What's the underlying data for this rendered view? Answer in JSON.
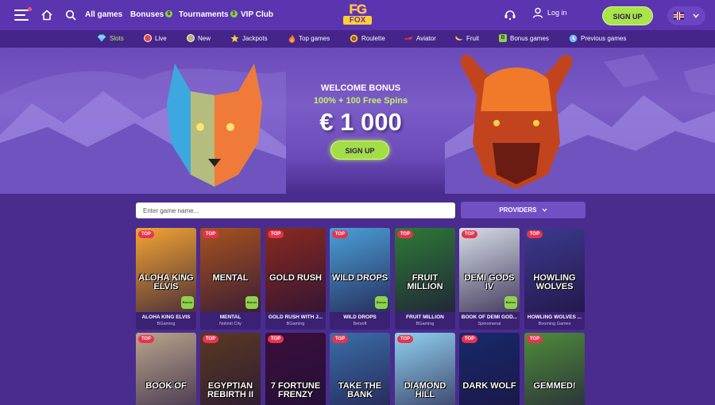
{
  "header": {
    "nav": [
      {
        "label": "All games",
        "badge": ""
      },
      {
        "label": "Bonuses",
        "badge": "6"
      },
      {
        "label": "Tournaments",
        "badge": "3"
      },
      {
        "label": "VIP Club",
        "badge": ""
      }
    ],
    "logo": {
      "line1": "FG",
      "line2": "FOX"
    },
    "login_label": "Log in",
    "signup_label": "SIGN UP",
    "language": "en-GB"
  },
  "categories": [
    {
      "label": "Slots",
      "icon": "diamond-icon",
      "active": true,
      "color": "#5ad1f0"
    },
    {
      "label": "Live",
      "icon": "live-ball-icon",
      "active": false,
      "color": "#e84545"
    },
    {
      "label": "New",
      "icon": "new-badge-icon",
      "active": false,
      "color": "#b9b36b"
    },
    {
      "label": "Jackpots",
      "icon": "star-icon",
      "active": false,
      "color": "#f7d23e"
    },
    {
      "label": "Top games",
      "icon": "fire-icon",
      "active": false,
      "color": "#ff7a2b"
    },
    {
      "label": "Roulette",
      "icon": "roulette-icon",
      "active": false,
      "color": "#f5b942"
    },
    {
      "label": "Aviator",
      "icon": "plane-icon",
      "active": false,
      "color": "#e33b4f"
    },
    {
      "label": "Fruit",
      "icon": "banana-icon",
      "active": false,
      "color": "#f8dd5a"
    },
    {
      "label": "Bonus games",
      "icon": "bonus-b-icon",
      "active": false,
      "color": "#8fd14f"
    },
    {
      "label": "Previous games",
      "icon": "history-icon",
      "active": false,
      "color": "#7ab8f5"
    }
  ],
  "hero": {
    "title": "WELCOME BONUS",
    "subtitle": "100% + 100 Free Spins",
    "amount": "€ 1 000",
    "button": "SIGN UP"
  },
  "search": {
    "placeholder": "Enter game name..."
  },
  "providers_label": "PROVIDERS",
  "games_row1": [
    {
      "name": "ALOHA KING ELVIS",
      "provider": "BGaming",
      "top": "TOP",
      "bonus": "Bonus",
      "art_text": "ALOHA KING ELVIS",
      "bg": "#f4a532"
    },
    {
      "name": "MENTAL",
      "provider": "Nolimit City",
      "top": "TOP",
      "bonus": "Bonus",
      "art_text": "MENTAL",
      "bg": "#a8521f"
    },
    {
      "name": "GOLD RUSH WITH J...",
      "provider": "BGaming",
      "top": "TOP",
      "bonus": "",
      "art_text": "GOLD RUSH",
      "bg": "#8a2a1e"
    },
    {
      "name": "WILD DROPS",
      "provider": "Betsoft",
      "top": "TOP",
      "bonus": "Bonus",
      "art_text": "WILD DROPS",
      "bg": "#4aa0d8"
    },
    {
      "name": "FRUIT MILLION",
      "provider": "BGaming",
      "top": "TOP",
      "bonus": "",
      "art_text": "FRUIT MILLION",
      "bg": "#2e7a36"
    },
    {
      "name": "BOOK OF DEMI GOD...",
      "provider": "Spinomenal",
      "top": "TOP",
      "bonus": "Bonus",
      "art_text": "DEMI GODS IV",
      "bg": "#d6dde6"
    },
    {
      "name": "HOWLING WOLVES ...",
      "provider": "Booming Games",
      "top": "TOP",
      "bonus": "",
      "art_text": "HOWLING WOLVES",
      "bg": "#3c3a8e"
    }
  ],
  "games_row2": [
    {
      "top": "TOP",
      "art_text": "BOOK OF",
      "bg": "#b9a58c"
    },
    {
      "top": "TOP",
      "art_text": "EGYPTIAN REBIRTH II",
      "bg": "#5a3a22"
    },
    {
      "top": "TOP",
      "art_text": "7 FORTUNE FRENZY",
      "bg": "#3a0f3a"
    },
    {
      "top": "TOP",
      "art_text": "TAKE THE BANK",
      "bg": "#3b6ea8"
    },
    {
      "top": "TOP",
      "art_text": "DIAMOND HILL",
      "bg": "#8fd0ef"
    },
    {
      "top": "TOP",
      "art_text": "DARK WOLF",
      "bg": "#172a6b"
    },
    {
      "top": "TOP",
      "art_text": "GEMMED!",
      "bg": "#4f8c3a"
    }
  ]
}
